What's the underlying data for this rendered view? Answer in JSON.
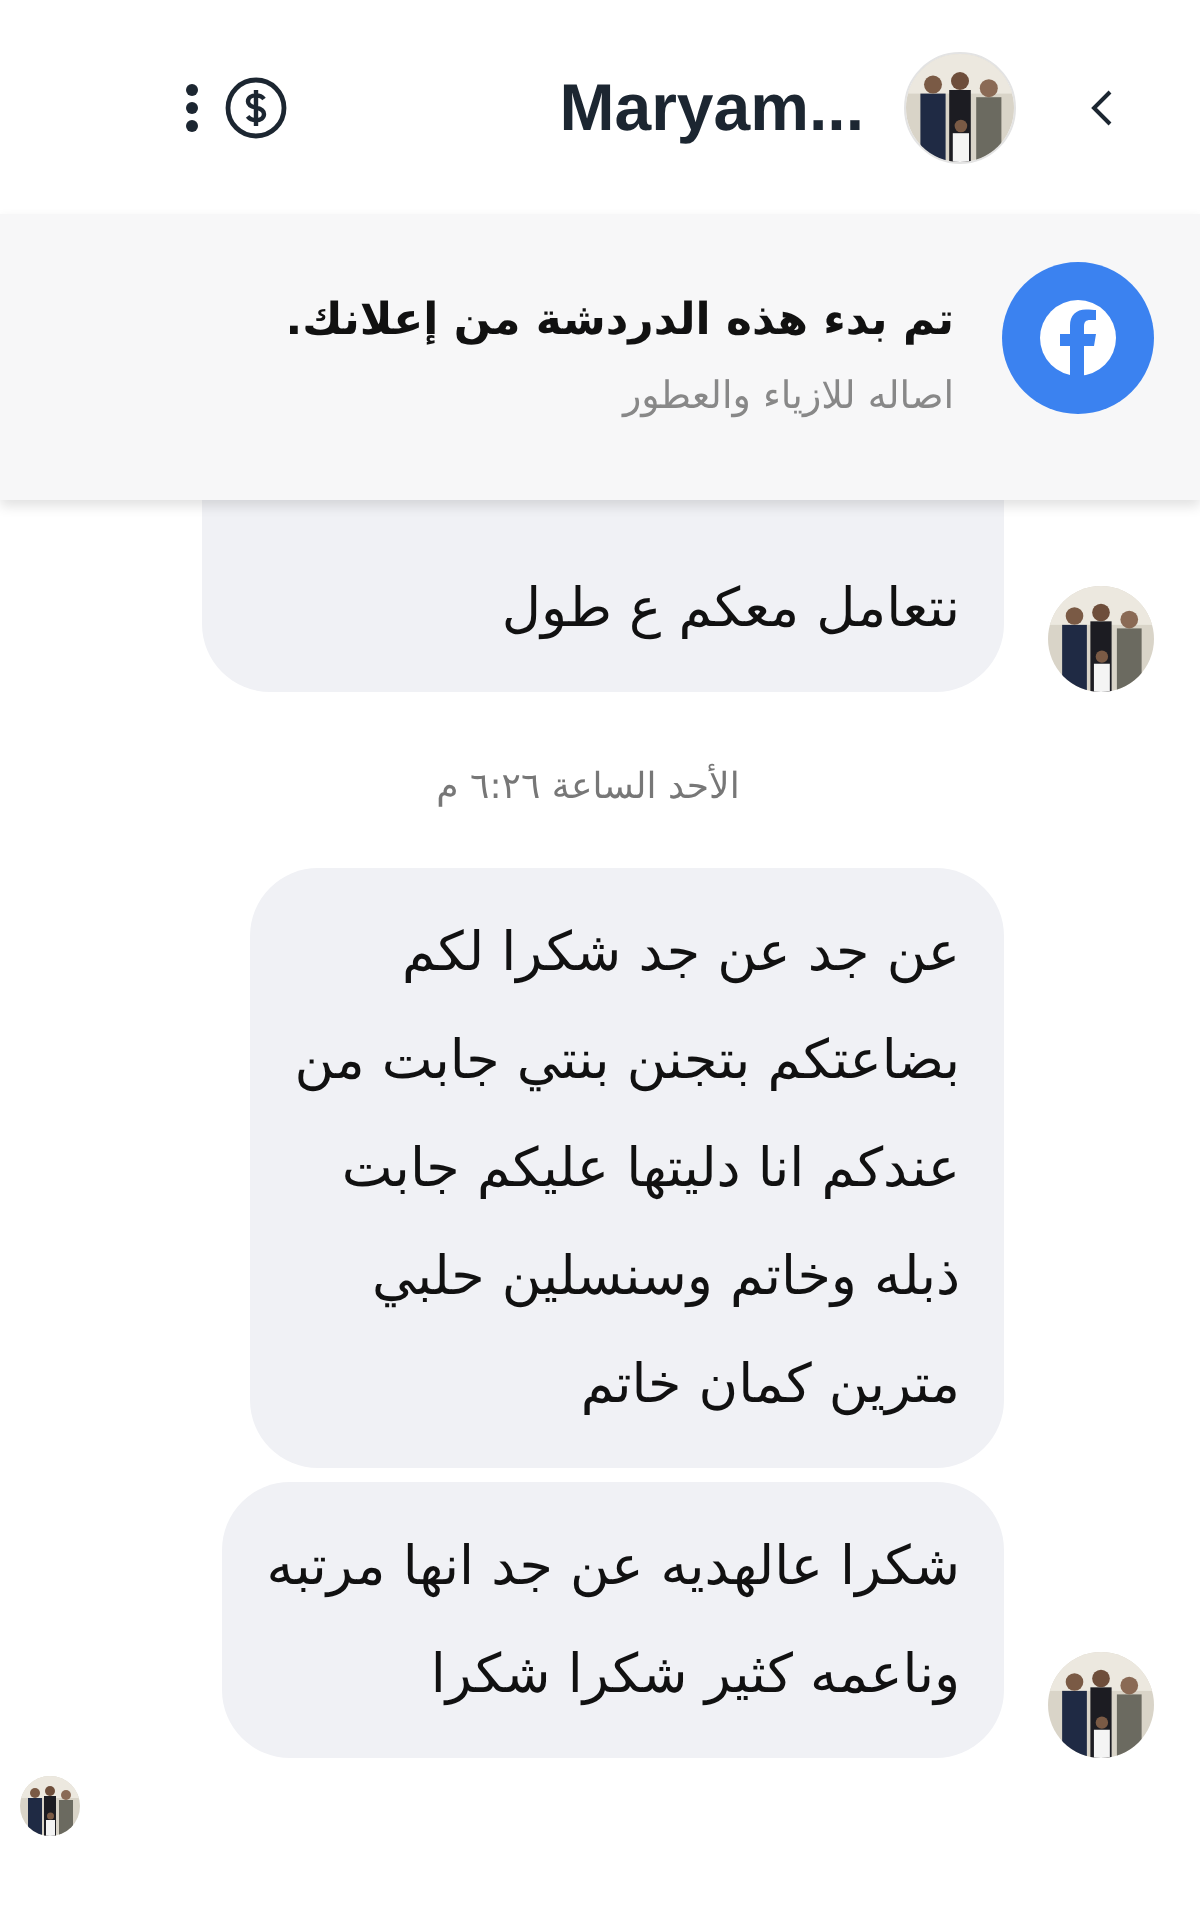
{
  "header": {
    "name": "Maryam..."
  },
  "banner": {
    "title": "تم بدء هذه الدردشة من إعلانك.",
    "subtitle": "اصاله للازياء والعطور"
  },
  "items": [
    {
      "kind": "message",
      "text": "نتعامل معكم ع طول",
      "show_avatar": true,
      "clipped_top": true
    },
    {
      "kind": "timestamp",
      "text": "الأحد الساعة ٦:٢٦ م"
    },
    {
      "kind": "message",
      "text": "عن جد عن جد شكرا لكم\nبضاعتكم بتجنن بنتي جابت من\nعندكم انا دليتها عليكم جابت\nذبله وخاتم وسنسلين حلبي\nمترين كمان خاتم",
      "show_avatar": false,
      "clipped_top": false
    },
    {
      "kind": "message",
      "text": "شكرا عالهديه عن جد انها مرتبه\nوناعمه كثير شكرا شكرا",
      "show_avatar": true,
      "clipped_top": false
    }
  ],
  "read_receipt": {
    "seen": true
  }
}
